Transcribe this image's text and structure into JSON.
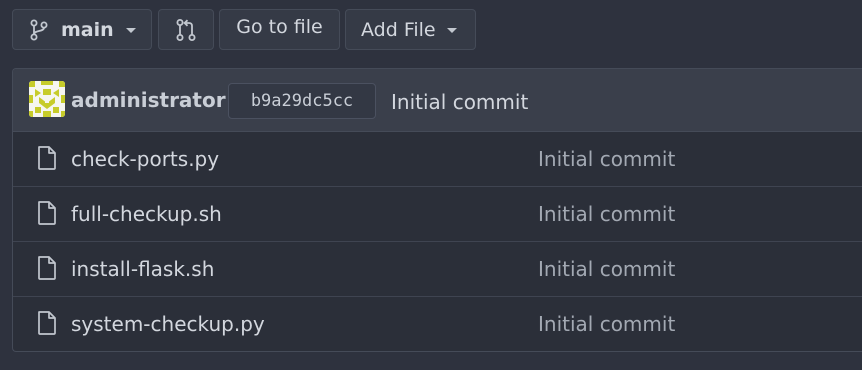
{
  "toolbar": {
    "branch": {
      "label": "main",
      "icon": "git-branch-icon"
    },
    "compare": {
      "icon": "git-pull-request-icon"
    },
    "go_to_file": {
      "label": "Go to file"
    },
    "add_file": {
      "label": "Add File"
    }
  },
  "latest_commit": {
    "author": "administrator",
    "sha": "b9a29dc5cc",
    "message": "Initial commit",
    "avatar_color": "#c7cc2a"
  },
  "files": [
    {
      "name": "check-ports.py",
      "commit_message": "Initial commit",
      "icon": "file-icon"
    },
    {
      "name": "full-checkup.sh",
      "commit_message": "Initial commit",
      "icon": "file-icon"
    },
    {
      "name": "install-flask.sh",
      "commit_message": "Initial commit",
      "icon": "file-icon"
    },
    {
      "name": "system-checkup.py",
      "commit_message": "Initial commit",
      "icon": "file-icon"
    }
  ]
}
